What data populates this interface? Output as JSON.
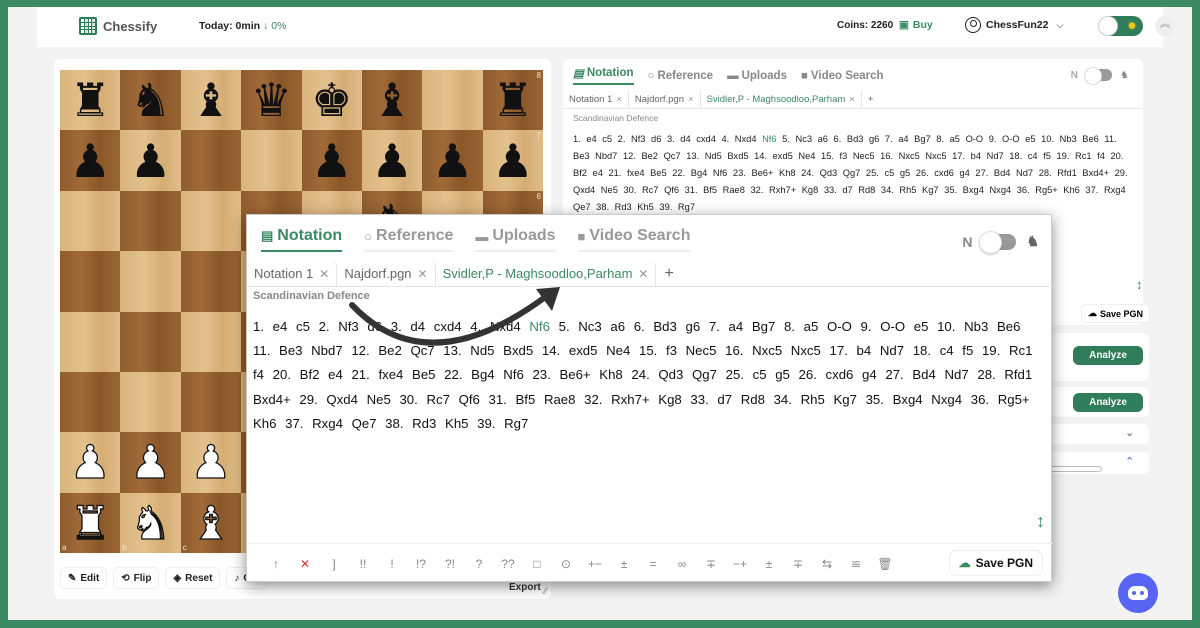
{
  "header": {
    "brand": "Chessify",
    "today_label": "Today: 0min",
    "today_change": "↓ 0%",
    "coins_label": "Coins: 2260",
    "buy_label": "Buy",
    "username": "ChessFun22"
  },
  "board": {
    "rank_labels": [
      "8",
      "7",
      "6"
    ],
    "file_labels": [
      "a",
      "b",
      "c"
    ],
    "position": [
      [
        "br",
        "bn",
        "bb",
        "bq",
        "bk",
        "bb",
        "",
        "br"
      ],
      [
        "bp",
        "bp",
        "",
        "",
        "bp",
        "bp",
        "bp",
        "bp"
      ],
      [
        "",
        "",
        "",
        "",
        "",
        "bn",
        "",
        ""
      ],
      [
        "",
        "",
        "",
        "",
        "",
        "",
        "",
        ""
      ],
      [
        "",
        "",
        "",
        "",
        "",
        "",
        "",
        ""
      ],
      [
        "",
        "",
        "",
        "",
        "",
        "",
        "",
        ""
      ],
      [
        "wp",
        "wp",
        "wp",
        "",
        "",
        "",
        "",
        ""
      ],
      [
        "wr",
        "wn",
        "wb",
        "",
        "",
        "",
        "",
        ""
      ]
    ],
    "actions": [
      {
        "label": "Edit",
        "icon": "pencil-icon"
      },
      {
        "label": "Flip",
        "icon": "flip-icon"
      },
      {
        "label": "Reset",
        "icon": "layers-icon"
      },
      {
        "label": "Off",
        "icon": "music-note-icon"
      }
    ],
    "import_export_label": "Import Export"
  },
  "notation_panel": {
    "tabs": [
      {
        "label": "Notation",
        "icon": "notes-icon",
        "active": true
      },
      {
        "label": "Reference",
        "icon": "search-icon",
        "active": false
      },
      {
        "label": "Uploads",
        "icon": "folder-icon",
        "active": false
      },
      {
        "label": "Video Search",
        "icon": "video-icon",
        "active": false
      }
    ],
    "toggle_label": "N",
    "file_tabs": [
      {
        "label": "Notation 1",
        "active": false
      },
      {
        "label": "Najdorf.pgn",
        "active": false
      },
      {
        "label": "Svidler,P - Maghsoodloo,Parham",
        "active": true
      }
    ],
    "opening": "Scandinavian Defence",
    "moves_before": "1. e4 c5 2. Nf3 d6 3. d4 cxd4 4. Nxd4",
    "highlighted_move": "Nf6",
    "moves_after": "5. Nc3 a6 6. Bd3 g6 7. a4 Bg7 8. a5 O-O 9. O-O e5 10. Nb3 Be6 11. Be3 Nbd7 12. Be2 Qc7 13. Nd5 Bxd5 14. exd5 Ne4 15. f3 Nec5 16. Nxc5 Nxc5 17. b4 Nd7 18. c4 f5 19. Rc1 f4 20. Bf2 e4 21. fxe4 Be5 22. Bg4 Nf6 23. Be6+ Kh8 24. Qd3 Qg7 25. c5 g5 26. cxd6 g4 27. Bd4 Nd7 28. Rfd1 Bxd4+ 29. Qxd4 Ne5 30. Rc7 Qf6 31. Bf5 Rae8 32. Rxh7+ Kg8 33. d7 Rd8 34. Rh5 Kg7 35. Bxg4 Nxg4 36. Rg5+ Kh6 37. Rxg4 Qe7 38. Rd3 Kh5 39. Rg7",
    "annotation_tools": [
      "↑",
      "✕",
      "]",
      "!!",
      "!",
      "!?",
      "?!",
      "?",
      "??",
      "□",
      "⊙",
      "+−",
      "±",
      "=",
      "∞",
      "∓",
      "−+",
      "±",
      "∓",
      "⇆",
      "≌",
      "🗑"
    ],
    "save_label": "Save PGN"
  },
  "analysis_cards": [
    {
      "button": "Analyze"
    },
    {
      "button": "Analyze"
    }
  ]
}
